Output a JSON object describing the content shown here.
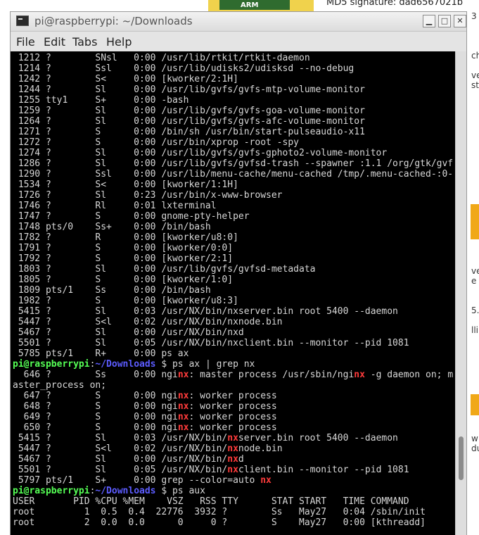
{
  "background": {
    "badge_text": "ARM",
    "md5_text": "MD5 signature:   dad6567021b",
    "right_fragments": [
      "3",
      "ch",
      "ve",
      "sta",
      "ve",
      "e",
      "5.",
      "lli",
      "w",
      "du"
    ]
  },
  "window": {
    "title": "pi@raspberrypi: ~/Downloads",
    "minimize_glyph": "▁",
    "maximize_glyph": "□",
    "close_glyph": "✕"
  },
  "menu": [
    "File",
    "Edit",
    "Tabs",
    "Help"
  ],
  "terminal": {
    "lines": [
      [
        [
          "",
          " 1212 ?        SNsl   0:00 /usr/lib/rtkit/rtkit-daemon"
        ]
      ],
      [
        [
          "",
          " 1214 ?        Ssl    0:00 /usr/lib/udisks2/udisksd --no-debug"
        ]
      ],
      [
        [
          "",
          " 1242 ?        S<     0:00 [kworker/2:1H]"
        ]
      ],
      [
        [
          "",
          " 1244 ?        Sl     0:00 /usr/lib/gvfs/gvfs-mtp-volume-monitor"
        ]
      ],
      [
        [
          "",
          " 1255 tty1     S+     0:00 -bash"
        ]
      ],
      [
        [
          "",
          " 1259 ?        Sl     0:00 /usr/lib/gvfs/gvfs-goa-volume-monitor"
        ]
      ],
      [
        [
          "",
          " 1264 ?        Sl     0:00 /usr/lib/gvfs/gvfs-afc-volume-monitor"
        ]
      ],
      [
        [
          "",
          " 1271 ?        S      0:00 /bin/sh /usr/bin/start-pulseaudio-x11"
        ]
      ],
      [
        [
          "",
          " 1272 ?        S      0:00 /usr/bin/xprop -root -spy"
        ]
      ],
      [
        [
          "",
          " 1274 ?        Sl     0:00 /usr/lib/gvfs/gvfs-gphoto2-volume-monitor"
        ]
      ],
      [
        [
          "",
          " 1286 ?        Sl     0:00 /usr/lib/gvfs/gvfsd-trash --spawner :1.1 /org/gtk/gvf"
        ]
      ],
      [
        [
          "",
          " 1290 ?        Ssl    0:00 /usr/lib/menu-cache/menu-cached /tmp/.menu-cached-:0-"
        ]
      ],
      [
        [
          "",
          " 1534 ?        S<     0:00 [kworker/1:1H]"
        ]
      ],
      [
        [
          "",
          " 1726 ?        Sl     0:23 /usr/bin/x-www-browser"
        ]
      ],
      [
        [
          "",
          " 1746 ?        Rl     0:01 lxterminal"
        ]
      ],
      [
        [
          "",
          " 1747 ?        S      0:00 gnome-pty-helper"
        ]
      ],
      [
        [
          "",
          " 1748 pts/0    Ss+    0:00 /bin/bash"
        ]
      ],
      [
        [
          "",
          " 1782 ?        R      0:00 [kworker/u8:0]"
        ]
      ],
      [
        [
          "",
          " 1791 ?        S      0:00 [kworker/0:0]"
        ]
      ],
      [
        [
          "",
          " 1792 ?        S      0:00 [kworker/2:1]"
        ]
      ],
      [
        [
          "",
          " 1803 ?        Sl     0:00 /usr/lib/gvfs/gvfsd-metadata"
        ]
      ],
      [
        [
          "",
          " 1805 ?        S      0:00 [kworker/1:0]"
        ]
      ],
      [
        [
          "",
          " 1809 pts/1    Ss     0:00 /bin/bash"
        ]
      ],
      [
        [
          "",
          " 1982 ?        S      0:00 [kworker/u8:3]"
        ]
      ],
      [
        [
          "",
          " 5415 ?        Sl     0:03 /usr/NX/bin/nxserver.bin root 5400 --daemon"
        ]
      ],
      [
        [
          "",
          " 5447 ?        S<l    0:02 /usr/NX/bin/nxnode.bin"
        ]
      ],
      [
        [
          "",
          " 5467 ?        Sl     0:00 /usr/NX/bin/nxd"
        ]
      ],
      [
        [
          "",
          " 5501 ?        Sl     0:05 /usr/NX/bin/nxclient.bin --monitor --pid 1081"
        ]
      ],
      [
        [
          "",
          " 5785 pts/1    R+     0:00 ps ax"
        ]
      ],
      [
        [
          "user",
          "pi@raspberrypi"
        ],
        [
          "",
          ":"
        ],
        [
          "path",
          "~/Downloads"
        ],
        [
          "",
          " $ ps ax | grep nx"
        ]
      ],
      [
        [
          "",
          "  646 ?        Ss     0:00 ngi"
        ],
        [
          "hl",
          "nx"
        ],
        [
          "",
          ": master process /usr/sbin/ngi"
        ],
        [
          "hl",
          "nx"
        ],
        [
          "",
          " -g daemon on; m"
        ]
      ],
      [
        [
          "",
          "aster_process on;"
        ]
      ],
      [
        [
          "",
          "  647 ?        S      0:00 ngi"
        ],
        [
          "hl",
          "nx"
        ],
        [
          "",
          ": worker process"
        ]
      ],
      [
        [
          "",
          "  648 ?        S      0:00 ngi"
        ],
        [
          "hl",
          "nx"
        ],
        [
          "",
          ": worker process"
        ]
      ],
      [
        [
          "",
          "  649 ?        S      0:00 ngi"
        ],
        [
          "hl",
          "nx"
        ],
        [
          "",
          ": worker process"
        ]
      ],
      [
        [
          "",
          "  650 ?        S      0:00 ngi"
        ],
        [
          "hl",
          "nx"
        ],
        [
          "",
          ": worker process"
        ]
      ],
      [
        [
          "",
          " 5415 ?        Sl     0:03 /usr/NX/bin/"
        ],
        [
          "hl",
          "nx"
        ],
        [
          "",
          "server.bin root 5400 --daemon"
        ]
      ],
      [
        [
          "",
          " 5447 ?        S<l    0:02 /usr/NX/bin/"
        ],
        [
          "hl",
          "nx"
        ],
        [
          "",
          "node.bin"
        ]
      ],
      [
        [
          "",
          " 5467 ?        Sl     0:00 /usr/NX/bin/"
        ],
        [
          "hl",
          "nx"
        ],
        [
          "",
          "d"
        ]
      ],
      [
        [
          "",
          " 5501 ?        Sl     0:05 /usr/NX/bin/"
        ],
        [
          "hl",
          "nx"
        ],
        [
          "",
          "client.bin --monitor --pid 1081"
        ]
      ],
      [
        [
          "",
          " 5797 pts/1    S+     0:00 grep --color=auto "
        ],
        [
          "hl",
          "nx"
        ]
      ],
      [
        [
          "user",
          "pi@raspberrypi"
        ],
        [
          "",
          ":"
        ],
        [
          "path",
          "~/Downloads"
        ],
        [
          "",
          " $ ps aux"
        ]
      ],
      [
        [
          "",
          "USER       PID %CPU %MEM    VSZ   RSS TTY      STAT START   TIME COMMAND"
        ]
      ],
      [
        [
          "",
          "root         1  0.5  0.4  22776  3932 ?        Ss   May27   0:04 /sbin/init"
        ]
      ],
      [
        [
          "",
          "root         2  0.0  0.0      0     0 ?        S    May27   0:00 [kthreadd]"
        ]
      ]
    ]
  },
  "scrollbar": {
    "position_fraction": 0.88
  }
}
